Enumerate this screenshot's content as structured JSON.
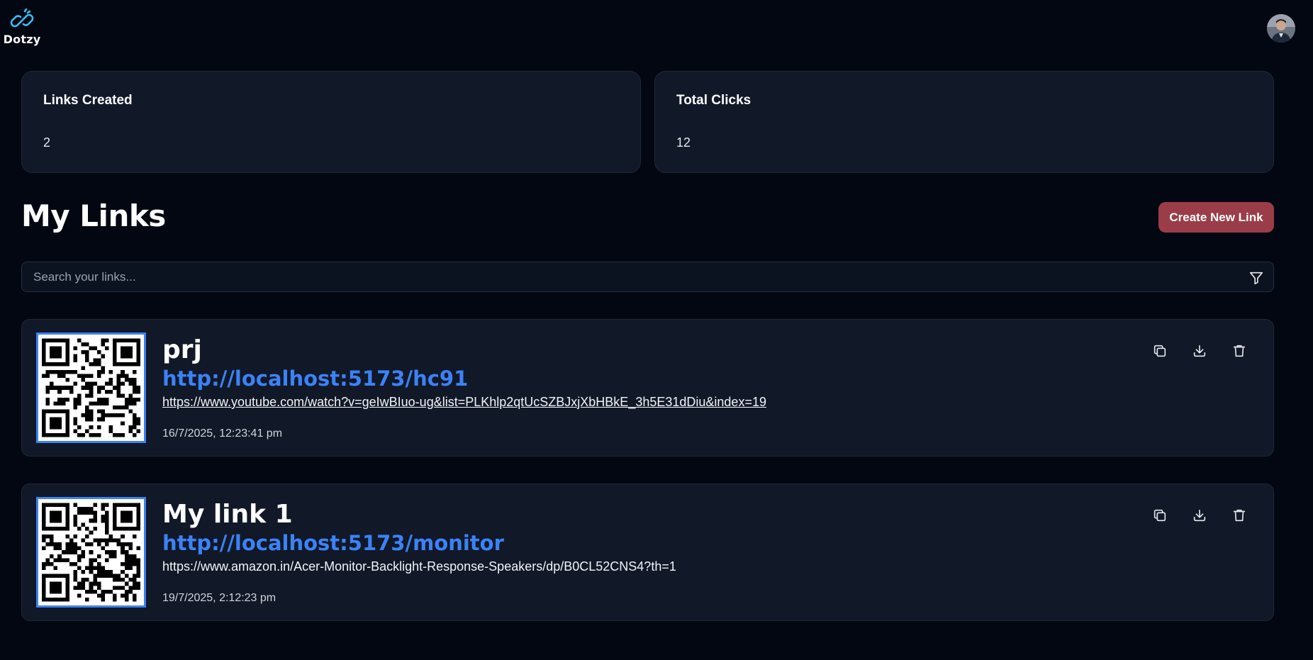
{
  "app": {
    "name": "Dotzy",
    "logo_icon": "link-logo-icon",
    "avatar_icon": "user-avatar"
  },
  "stats": [
    {
      "title": "Links Created",
      "value": "2"
    },
    {
      "title": "Total Clicks",
      "value": "12"
    }
  ],
  "links_section": {
    "title": "My Links",
    "create_button": "Create New Link",
    "search_placeholder": "Search your links...",
    "filter_icon": "filter-icon"
  },
  "links": [
    {
      "title": "prj",
      "short_url": "http://localhost:5173/hc91",
      "long_url": "https://www.youtube.com/watch?v=geIwBIuo-ug&list=PLKhlp2qtUcSZBJxjXbHBkE_3h5E31dDiu&index=19",
      "long_url_underlined": true,
      "created_at": "16/7/2025, 12:23:41 pm"
    },
    {
      "title": "My link 1",
      "short_url": "http://localhost:5173/monitor",
      "long_url": "https://www.amazon.in/Acer-Monitor-Backlight-Response-Speakers/dp/B0CL52CNS4?th=1",
      "long_url_underlined": false,
      "created_at": "19/7/2025, 2:12:23 pm"
    }
  ],
  "actions": [
    "copy-icon",
    "download-icon",
    "trash-icon"
  ],
  "colors": {
    "background": "#030712",
    "card": "#111827",
    "accent_blue": "#3b82f6",
    "create_button": "#9b3d48",
    "logo": "#38bdf8"
  }
}
